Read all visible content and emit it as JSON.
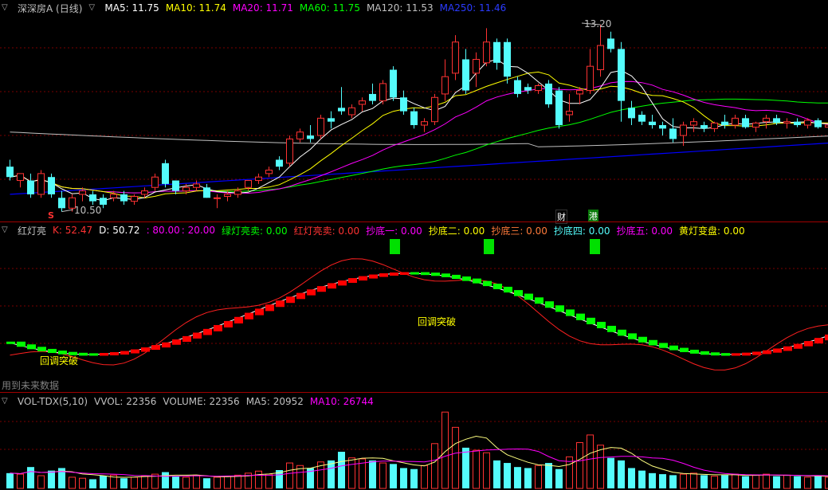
{
  "colors": {
    "up": "#ff3232",
    "down": "#54fcfc",
    "ma5": "#ffffff",
    "ma10": "#ffff00",
    "ma20": "#ff00ff",
    "ma60": "#00ff00",
    "ma120": "#c0c0c0",
    "ma250": "#0000ff",
    "grid": "#7a0000"
  },
  "price_panel": {
    "title": "深深房A (日线)",
    "ma5": "MA5: 11.75",
    "ma10": "MA10: 11.74",
    "ma20": "MA20: 11.71",
    "ma60": "MA60: 11.75",
    "ma120": "MA120: 11.53",
    "ma250": "MA250: 11.46",
    "high_label": "13.20",
    "low_label": "10.50",
    "marker_s": "S",
    "marker_cai": "财",
    "marker_gang": "港"
  },
  "indicator_panel": {
    "title": "红灯亮",
    "k": "K: 52.47",
    "d": "D: 50.72",
    "l80": ": 80.00",
    "l20": ": 20.00",
    "green_sell": "绿灯亮卖: 0.00",
    "red_sell": "红灯亮卖: 0.00",
    "bottom1": "抄底一: 0.00",
    "bottom2": "抄底二: 0.00",
    "bottom3": "抄底三: 0.00",
    "bottom4": "抄底四: 0.00",
    "bottom5": "抄底五: 0.00",
    "yellow": "黄灯变盘: 0.00",
    "callout1": "回调突破",
    "callout2": "回调突破",
    "footnote": "用到未来数据"
  },
  "volume_panel": {
    "title": "VOL-TDX(5,10)",
    "vvol": "VVOL: 22356",
    "volume": "VOLUME: 22356",
    "ma5": "MA5: 20952",
    "ma10": "MA10: 26744"
  },
  "chart_data": {
    "type": "candlestick",
    "bars": [
      {
        "o": 11.15,
        "h": 11.25,
        "l": 10.95,
        "c": 11.0
      },
      {
        "o": 10.95,
        "h": 11.05,
        "l": 10.85,
        "c": 11.05
      },
      {
        "o": 10.95,
        "h": 11.05,
        "l": 10.7,
        "c": 10.75
      },
      {
        "o": 10.75,
        "h": 11.1,
        "l": 10.7,
        "c": 11.05
      },
      {
        "o": 11.0,
        "h": 11.05,
        "l": 10.7,
        "c": 10.75
      },
      {
        "o": 10.7,
        "h": 10.8,
        "l": 10.5,
        "c": 10.55
      },
      {
        "o": 10.55,
        "h": 10.75,
        "l": 10.5,
        "c": 10.7
      },
      {
        "o": 10.75,
        "h": 10.85,
        "l": 10.65,
        "c": 10.8
      },
      {
        "o": 10.75,
        "h": 10.8,
        "l": 10.6,
        "c": 10.65
      },
      {
        "o": 10.7,
        "h": 10.75,
        "l": 10.55,
        "c": 10.6
      },
      {
        "o": 10.7,
        "h": 10.8,
        "l": 10.65,
        "c": 10.75
      },
      {
        "o": 10.75,
        "h": 10.8,
        "l": 10.6,
        "c": 10.65
      },
      {
        "o": 10.65,
        "h": 10.75,
        "l": 10.6,
        "c": 10.72
      },
      {
        "o": 10.75,
        "h": 10.85,
        "l": 10.7,
        "c": 10.8
      },
      {
        "o": 10.85,
        "h": 11.05,
        "l": 10.8,
        "c": 11.0
      },
      {
        "o": 11.2,
        "h": 11.25,
        "l": 10.85,
        "c": 10.9
      },
      {
        "o": 10.95,
        "h": 10.95,
        "l": 10.75,
        "c": 10.8
      },
      {
        "o": 10.8,
        "h": 10.9,
        "l": 10.75,
        "c": 10.85
      },
      {
        "o": 10.85,
        "h": 10.95,
        "l": 10.8,
        "c": 10.9
      },
      {
        "o": 10.85,
        "h": 10.9,
        "l": 10.7,
        "c": 10.7
      },
      {
        "o": 10.7,
        "h": 10.75,
        "l": 10.55,
        "c": 10.7
      },
      {
        "o": 10.72,
        "h": 10.8,
        "l": 10.65,
        "c": 10.75
      },
      {
        "o": 10.75,
        "h": 10.85,
        "l": 10.7,
        "c": 10.8
      },
      {
        "o": 10.85,
        "h": 10.95,
        "l": 10.8,
        "c": 10.95
      },
      {
        "o": 10.95,
        "h": 11.05,
        "l": 10.9,
        "c": 11.0
      },
      {
        "o": 11.05,
        "h": 11.15,
        "l": 11.0,
        "c": 11.1
      },
      {
        "o": 11.25,
        "h": 11.3,
        "l": 11.1,
        "c": 11.15
      },
      {
        "o": 11.2,
        "h": 11.6,
        "l": 11.15,
        "c": 11.55
      },
      {
        "o": 11.55,
        "h": 11.7,
        "l": 11.5,
        "c": 11.65
      },
      {
        "o": 11.6,
        "h": 11.75,
        "l": 11.5,
        "c": 11.55
      },
      {
        "o": 11.6,
        "h": 11.9,
        "l": 11.55,
        "c": 11.85
      },
      {
        "o": 11.85,
        "h": 11.95,
        "l": 11.7,
        "c": 11.8
      },
      {
        "o": 12.0,
        "h": 12.3,
        "l": 11.9,
        "c": 11.95
      },
      {
        "o": 11.9,
        "h": 12.05,
        "l": 11.85,
        "c": 12.0
      },
      {
        "o": 12.05,
        "h": 12.15,
        "l": 11.95,
        "c": 12.1
      },
      {
        "o": 12.2,
        "h": 12.35,
        "l": 12.05,
        "c": 12.1
      },
      {
        "o": 12.1,
        "h": 12.4,
        "l": 12.05,
        "c": 12.35
      },
      {
        "o": 12.55,
        "h": 12.6,
        "l": 12.1,
        "c": 12.15
      },
      {
        "o": 12.15,
        "h": 12.25,
        "l": 11.9,
        "c": 11.95
      },
      {
        "o": 11.95,
        "h": 12.0,
        "l": 11.7,
        "c": 11.75
      },
      {
        "o": 11.75,
        "h": 11.85,
        "l": 11.65,
        "c": 11.8
      },
      {
        "o": 11.8,
        "h": 12.2,
        "l": 11.75,
        "c": 12.15
      },
      {
        "o": 12.2,
        "h": 12.7,
        "l": 12.1,
        "c": 12.45
      },
      {
        "o": 12.5,
        "h": 13.05,
        "l": 12.4,
        "c": 12.95
      },
      {
        "o": 12.7,
        "h": 12.85,
        "l": 12.2,
        "c": 12.25
      },
      {
        "o": 12.5,
        "h": 12.8,
        "l": 12.3,
        "c": 12.7
      },
      {
        "o": 12.65,
        "h": 13.15,
        "l": 12.6,
        "c": 12.95
      },
      {
        "o": 12.95,
        "h": 13.0,
        "l": 12.55,
        "c": 12.65
      },
      {
        "o": 12.95,
        "h": 13.0,
        "l": 12.35,
        "c": 12.45
      },
      {
        "o": 12.4,
        "h": 12.45,
        "l": 12.15,
        "c": 12.2
      },
      {
        "o": 12.3,
        "h": 12.35,
        "l": 12.2,
        "c": 12.25
      },
      {
        "o": 12.25,
        "h": 12.35,
        "l": 12.2,
        "c": 12.32
      },
      {
        "o": 12.35,
        "h": 12.4,
        "l": 12.0,
        "c": 12.05
      },
      {
        "o": 12.25,
        "h": 12.3,
        "l": 11.7,
        "c": 11.75
      },
      {
        "o": 11.9,
        "h": 12.2,
        "l": 11.8,
        "c": 11.95
      },
      {
        "o": 12.2,
        "h": 12.3,
        "l": 12.05,
        "c": 12.25
      },
      {
        "o": 12.25,
        "h": 12.85,
        "l": 12.2,
        "c": 12.6
      },
      {
        "o": 12.55,
        "h": 13.2,
        "l": 12.45,
        "c": 12.9
      },
      {
        "o": 13.0,
        "h": 13.1,
        "l": 12.8,
        "c": 12.85
      },
      {
        "o": 12.85,
        "h": 12.95,
        "l": 11.8,
        "c": 12.1
      },
      {
        "o": 12.0,
        "h": 12.1,
        "l": 11.75,
        "c": 11.85
      },
      {
        "o": 11.9,
        "h": 11.95,
        "l": 11.75,
        "c": 11.8
      },
      {
        "o": 11.8,
        "h": 11.9,
        "l": 11.7,
        "c": 11.75
      },
      {
        "o": 11.75,
        "h": 11.8,
        "l": 11.6,
        "c": 11.7
      },
      {
        "o": 11.7,
        "h": 11.85,
        "l": 11.5,
        "c": 11.55
      },
      {
        "o": 11.6,
        "h": 11.8,
        "l": 11.45,
        "c": 11.75
      },
      {
        "o": 11.75,
        "h": 11.85,
        "l": 11.65,
        "c": 11.8
      },
      {
        "o": 11.75,
        "h": 11.8,
        "l": 11.65,
        "c": 11.7
      },
      {
        "o": 11.7,
        "h": 11.8,
        "l": 11.65,
        "c": 11.78
      },
      {
        "o": 11.8,
        "h": 11.9,
        "l": 11.7,
        "c": 11.75
      },
      {
        "o": 11.75,
        "h": 11.9,
        "l": 11.7,
        "c": 11.85
      },
      {
        "o": 11.85,
        "h": 11.9,
        "l": 11.7,
        "c": 11.72
      },
      {
        "o": 11.72,
        "h": 11.8,
        "l": 11.65,
        "c": 11.78
      },
      {
        "o": 11.8,
        "h": 11.9,
        "l": 11.7,
        "c": 11.85
      },
      {
        "o": 11.85,
        "h": 11.9,
        "l": 11.75,
        "c": 11.78
      },
      {
        "o": 11.78,
        "h": 11.85,
        "l": 11.7,
        "c": 11.8
      },
      {
        "o": 11.8,
        "h": 11.85,
        "l": 11.72,
        "c": 11.75
      },
      {
        "o": 11.75,
        "h": 11.85,
        "l": 11.7,
        "c": 11.82
      },
      {
        "o": 11.82,
        "h": 11.85,
        "l": 11.7,
        "c": 11.72
      },
      {
        "o": 11.72,
        "h": 11.8,
        "l": 11.65,
        "c": 11.75
      }
    ],
    "volume": [
      30,
      28,
      42,
      25,
      35,
      40,
      22,
      20,
      18,
      25,
      26,
      20,
      22,
      24,
      28,
      32,
      24,
      22,
      26,
      20,
      22,
      24,
      26,
      30,
      34,
      28,
      36,
      50,
      45,
      40,
      52,
      55,
      72,
      60,
      58,
      55,
      50,
      48,
      40,
      38,
      45,
      88,
      150,
      120,
      80,
      75,
      70,
      55,
      50,
      42,
      40,
      45,
      50,
      38,
      62,
      90,
      105,
      85,
      60,
      55,
      40,
      35,
      30,
      28,
      26,
      28,
      30,
      26,
      24,
      26,
      28,
      24,
      26,
      28,
      24,
      26,
      24,
      22,
      25,
      22
    ],
    "vol_ma5_note": "computed in script",
    "price_range": [
      10.45,
      13.35
    ]
  }
}
